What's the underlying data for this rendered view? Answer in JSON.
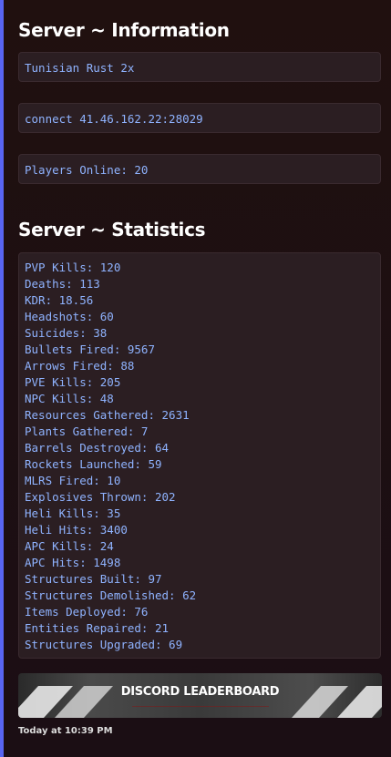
{
  "colors": {
    "accent_bar": "#5865f2",
    "code_text": "#8fb3ff",
    "code_background": "#2b1e22",
    "title_text": "#ffffff"
  },
  "info_section": {
    "title": "Server ~ Information",
    "server_name": "Tunisian Rust 2x",
    "connect": "connect 41.46.162.22:28029",
    "players_online": "Players Online: 20"
  },
  "stats_section": {
    "title": "Server ~ Statistics",
    "lines": [
      "PVP Kills: 120",
      "Deaths: 113",
      "KDR: 18.56",
      "Headshots: 60",
      "Suicides: 38",
      "Bullets Fired: 9567",
      "Arrows Fired: 88",
      "PVE Kills: 205",
      "NPC Kills: 48",
      "Resources Gathered: 2631",
      "Plants Gathered: 7",
      "Barrels Destroyed: 64",
      "Rockets Launched: 59",
      "MLRS Fired: 10",
      "Explosives Thrown: 202",
      "Heli Kills: 35",
      "Heli Hits: 3400",
      "APC Kills: 24",
      "APC Hits: 1498",
      "Structures Built: 97",
      "Structures Demolished: 62",
      "Items Deployed: 76",
      "Entities Repaired: 21",
      "Structures Upgraded: 69"
    ]
  },
  "banner": {
    "title": "DISCORD LEADERBOARD",
    "icon": "leaderboard-banner-image"
  },
  "footer": {
    "timestamp": "Today at 10:39 PM"
  }
}
